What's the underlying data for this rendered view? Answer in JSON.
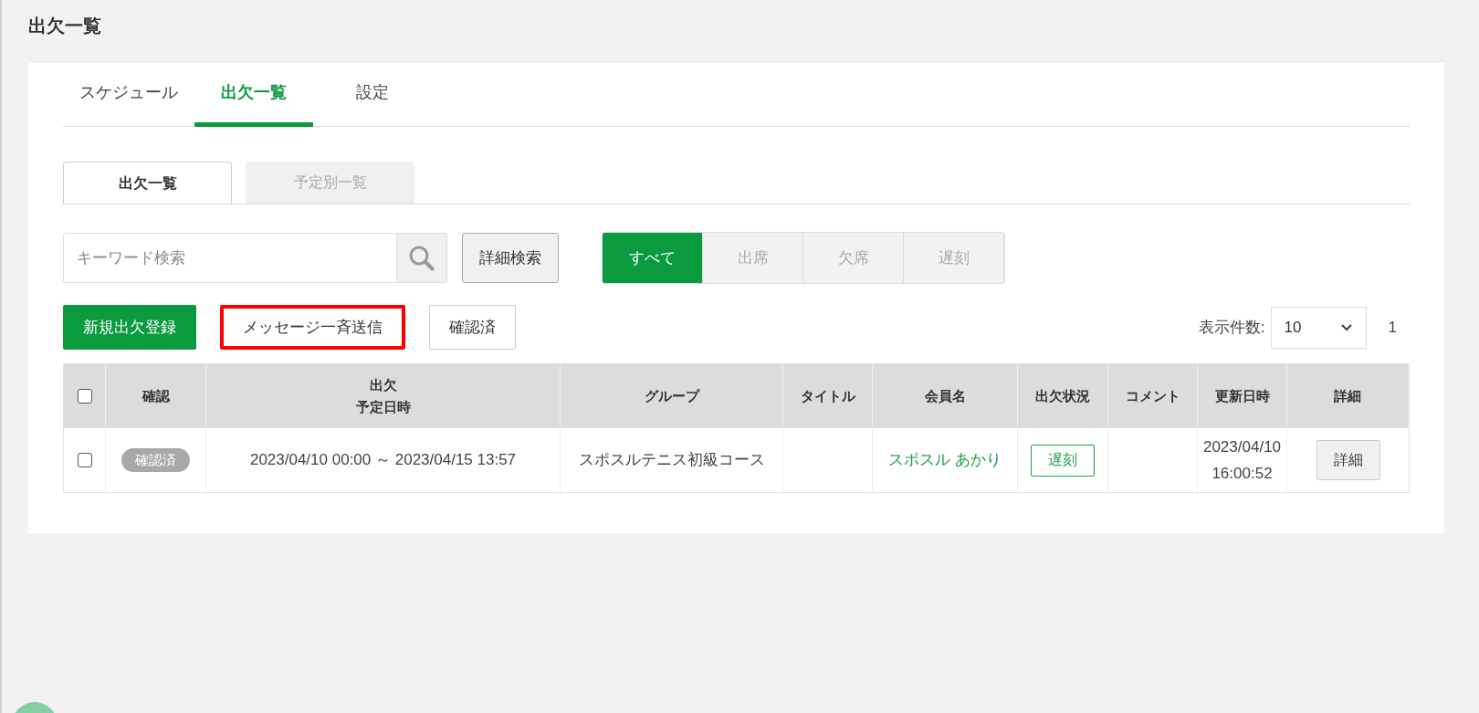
{
  "page_title": "出欠一覧",
  "tabs": [
    {
      "label": "スケジュール",
      "selected": false
    },
    {
      "label": "出欠一覧",
      "selected": true
    },
    {
      "label": "設定",
      "selected": false
    }
  ],
  "sub_tabs": [
    {
      "label": "出欠一覧",
      "selected": true
    },
    {
      "label": "予定別一覧",
      "selected": false
    }
  ],
  "search": {
    "placeholder": "キーワード検索"
  },
  "advanced_search_button": "詳細検索",
  "filters": [
    {
      "label": "すべて",
      "selected": true
    },
    {
      "label": "出席",
      "selected": false
    },
    {
      "label": "欠席",
      "selected": false
    },
    {
      "label": "遅刻",
      "selected": false
    }
  ],
  "actions": [
    {
      "label": "新規出欠登録",
      "kind": "primary",
      "highlighted": false
    },
    {
      "label": "メッセージ一斉送信",
      "kind": "outline",
      "highlighted": true
    },
    {
      "label": "確認済",
      "kind": "outline",
      "highlighted": false
    }
  ],
  "page_size": {
    "label": "表示件数:",
    "value": "10"
  },
  "pagination": [
    "1"
  ],
  "table": {
    "header_checked": false,
    "columns": [
      [
        "確認"
      ],
      [
        "出欠",
        "予定日時"
      ],
      [
        "グループ"
      ],
      [
        "タイトル"
      ],
      [
        "会員名"
      ],
      [
        "出欠状況"
      ],
      [
        "コメント"
      ],
      [
        "更新日時"
      ],
      [
        "詳細"
      ]
    ],
    "rows": [
      {
        "checked": false,
        "confirmed": "確認済",
        "schedule": "2023/04/10 00:00 ～ 2023/04/15 13:57",
        "group": "スポスルテニス初級コース",
        "title": "",
        "member": "スポスル あかり",
        "status": "遅刻",
        "updated": [
          "2023/04/10",
          "16:00:52"
        ],
        "detail": "詳細"
      }
    ]
  }
}
